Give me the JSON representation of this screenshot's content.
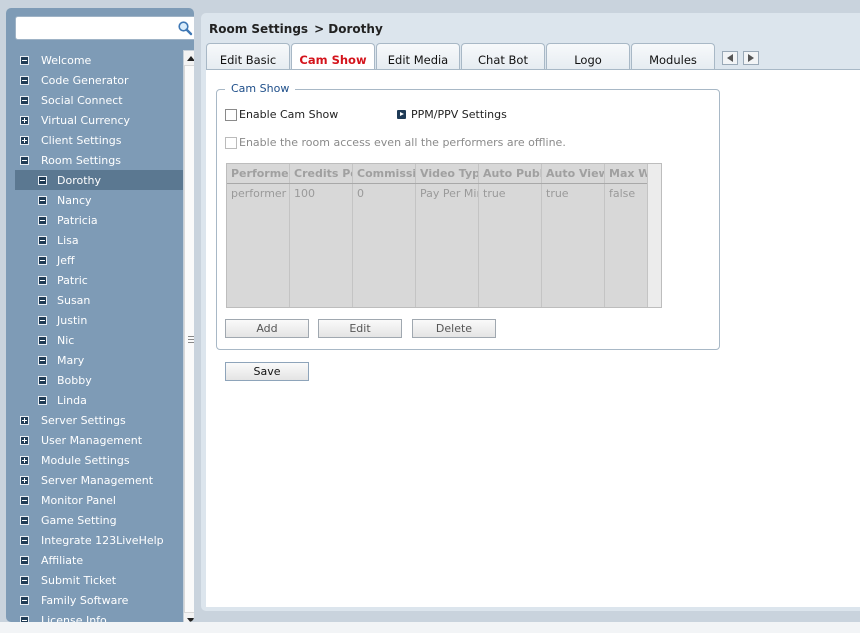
{
  "search": {
    "placeholder": "",
    "value": ""
  },
  "sidebar": {
    "items": [
      {
        "label": "Welcome",
        "level": 0,
        "expander": "minus"
      },
      {
        "label": "Code Generator",
        "level": 0,
        "expander": "minus"
      },
      {
        "label": "Social Connect",
        "level": 0,
        "expander": "minus"
      },
      {
        "label": "Virtual Currency",
        "level": 0,
        "expander": "plus"
      },
      {
        "label": "Client Settings",
        "level": 0,
        "expander": "plus"
      },
      {
        "label": "Room Settings",
        "level": 0,
        "expander": "minus"
      },
      {
        "label": "Dorothy",
        "level": 1,
        "expander": "minus",
        "selected": true
      },
      {
        "label": "Nancy",
        "level": 1,
        "expander": "minus"
      },
      {
        "label": "Patricia",
        "level": 1,
        "expander": "minus"
      },
      {
        "label": "Lisa",
        "level": 1,
        "expander": "minus"
      },
      {
        "label": "Jeff",
        "level": 1,
        "expander": "minus"
      },
      {
        "label": "Patric",
        "level": 1,
        "expander": "minus"
      },
      {
        "label": "Susan",
        "level": 1,
        "expander": "minus"
      },
      {
        "label": "Justin",
        "level": 1,
        "expander": "minus"
      },
      {
        "label": "Nic",
        "level": 1,
        "expander": "minus"
      },
      {
        "label": "Mary",
        "level": 1,
        "expander": "minus"
      },
      {
        "label": "Bobby",
        "level": 1,
        "expander": "minus"
      },
      {
        "label": "Linda",
        "level": 1,
        "expander": "minus"
      },
      {
        "label": "Server Settings",
        "level": 0,
        "expander": "plus"
      },
      {
        "label": "User Management",
        "level": 0,
        "expander": "plus"
      },
      {
        "label": "Module Settings",
        "level": 0,
        "expander": "plus"
      },
      {
        "label": "Server Management",
        "level": 0,
        "expander": "plus"
      },
      {
        "label": "Monitor Panel",
        "level": 0,
        "expander": "minus"
      },
      {
        "label": "Game Setting",
        "level": 0,
        "expander": "minus"
      },
      {
        "label": "Integrate 123LiveHelp",
        "level": 0,
        "expander": "minus"
      },
      {
        "label": "Affiliate",
        "level": 0,
        "expander": "minus"
      },
      {
        "label": "Submit Ticket",
        "level": 0,
        "expander": "minus"
      },
      {
        "label": "Family Software",
        "level": 0,
        "expander": "minus"
      },
      {
        "label": "License Info",
        "level": 0,
        "expander": "minus"
      }
    ]
  },
  "breadcrumb": {
    "section": "Room Settings",
    "current": "> Dorothy"
  },
  "tabs": [
    {
      "label": "Edit Basic",
      "active": false
    },
    {
      "label": "Cam Show",
      "active": true
    },
    {
      "label": "Edit Media",
      "active": false
    },
    {
      "label": "Chat Bot",
      "active": false
    },
    {
      "label": "Logo",
      "active": false
    },
    {
      "label": "Modules",
      "active": false
    }
  ],
  "cam_show": {
    "legend": "Cam Show",
    "enable_label": "Enable Cam Show",
    "ppm_label": "PPM/PPV Settings",
    "offline_label": "Enable the room access even all the performers are offline.",
    "columns": [
      "Performe",
      "Credits Pe",
      "Commissi",
      "Video Typ",
      "Auto Publ",
      "Auto View",
      "Max W"
    ],
    "rows": [
      [
        "performer",
        "100",
        "0",
        "Pay Per Mint",
        "true",
        "true",
        "false"
      ]
    ],
    "add_label": "Add",
    "edit_label": "Edit",
    "delete_label": "Delete",
    "save_label": "Save"
  },
  "colors": {
    "sidebar_bg": "#7e9bb6",
    "selected_bg": "#5b7891",
    "active_tab_text": "#d4141c",
    "legend_text": "#1f4f8a"
  }
}
